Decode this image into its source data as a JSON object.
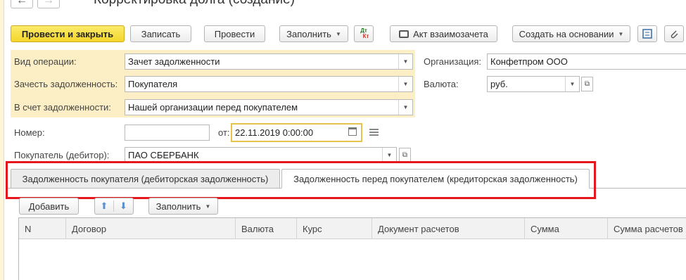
{
  "window": {
    "title": "Корректировка долга (создание)"
  },
  "nav": {
    "back": "←",
    "forward": "→"
  },
  "toolbar": {
    "post_close": "Провести и закрыть",
    "save": "Записать",
    "post": "Провести",
    "fill": "Заполнить",
    "dt_kt": {
      "dt": "Дт",
      "kt": "Кт"
    },
    "act_offset": "Акт взаимозачета",
    "create_based_on": "Создать на основании"
  },
  "form": {
    "operation_type": {
      "label": "Вид операции:",
      "value": "Зачет задолженности"
    },
    "offset_debt": {
      "label": "Зачесть задолженность:",
      "value": "Покупателя"
    },
    "against_debt": {
      "label": "В счет задолженности:",
      "value": "Нашей организации перед покупателем"
    },
    "organization": {
      "label": "Организация:",
      "value": "Конфетпром ООО"
    },
    "currency": {
      "label": "Валюта:",
      "value": "руб."
    },
    "number": {
      "label": "Номер:",
      "value": ""
    },
    "date": {
      "label": "от:",
      "value": "22.11.2019  0:00:00"
    },
    "buyer": {
      "label": "Покупатель (дебитор):",
      "value": "ПАО СБЕРБАНК"
    }
  },
  "tabs": [
    {
      "label": "Задолженность покупателя (дебиторская задолженность)",
      "active": false
    },
    {
      "label": "Задолженность перед покупателем (кредиторская задолженность)",
      "active": true
    }
  ],
  "table_toolbar": {
    "add": "Добавить",
    "fill": "Заполнить"
  },
  "table": {
    "columns": [
      "N",
      "Договор",
      "Валюта",
      "Курс",
      "Документ расчетов",
      "Сумма",
      "Сумма расчетов"
    ]
  },
  "colors": {
    "primary": "#f4d629",
    "highlight_frame": "#e5161c",
    "field_group": "#fdefc5"
  }
}
